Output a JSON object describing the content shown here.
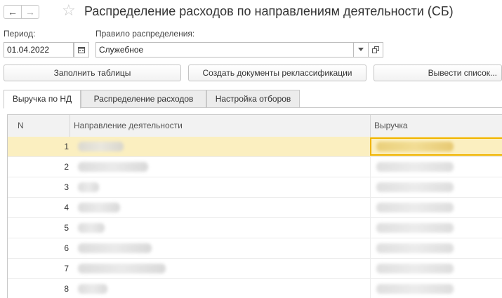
{
  "header": {
    "title": "Распределение расходов по направлениям деятельности (СБ)",
    "back_icon": "←",
    "forward_icon": "→",
    "star_icon": "☆"
  },
  "form": {
    "period_label": "Период:",
    "period_value": "01.04.2022",
    "rule_label": "Правило распределения:",
    "rule_value": "Служебное"
  },
  "toolbar": {
    "fill_tables": "Заполнить таблицы",
    "create_docs": "Создать документы реклассификации",
    "output_list": "Вывести список..."
  },
  "tabs": [
    {
      "label": "Выручка по НД",
      "active": true
    },
    {
      "label": "Распределение расходов",
      "active": false
    },
    {
      "label": "Настройка отборов",
      "active": false
    }
  ],
  "table": {
    "columns": [
      "N",
      "Направление деятельности",
      "Выручка"
    ],
    "rows": [
      {
        "n": "1"
      },
      {
        "n": "2"
      },
      {
        "n": "3"
      },
      {
        "n": "4"
      },
      {
        "n": "5"
      },
      {
        "n": "6"
      },
      {
        "n": "7"
      },
      {
        "n": "8"
      }
    ]
  }
}
